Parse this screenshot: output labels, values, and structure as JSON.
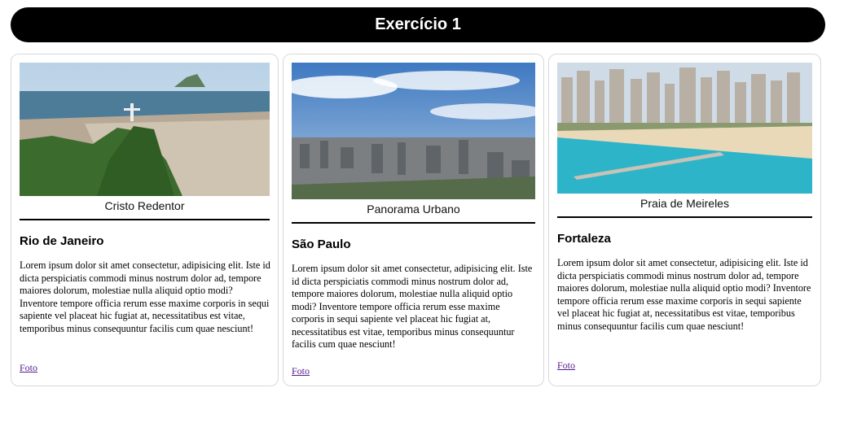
{
  "header": {
    "title": "Exercício 1"
  },
  "cards": [
    {
      "caption": "Cristo Redentor",
      "city": "Rio de Janeiro",
      "text": "Lorem ipsum dolor sit amet consectetur, adipisicing elit. Iste id dicta perspiciatis commodi minus nostrum dolor ad, tempore maiores dolorum, molestiae nulla aliquid optio modi? Inventore tempore officia rerum esse maxime corporis in sequi sapiente vel placeat hic fugiat at, necessitatibus est vitae, temporibus minus consequuntur facilis cum quae nesciunt!",
      "link": "Foto"
    },
    {
      "caption": "Panorama Urbano",
      "city": "São Paulo",
      "text": "Lorem ipsum dolor sit amet consectetur, adipisicing elit. Iste id dicta perspiciatis commodi minus nostrum dolor ad, tempore maiores dolorum, molestiae nulla aliquid optio modi? Inventore tempore officia rerum esse maxime corporis in sequi sapiente vel placeat hic fugiat at, necessitatibus est vitae, temporibus minus consequuntur facilis cum quae nesciunt!",
      "link": "Foto"
    },
    {
      "caption": "Praia de Meireles",
      "city": "Fortaleza",
      "text": "Lorem ipsum dolor sit amet consectetur, adipisicing elit. Iste id dicta perspiciatis commodi minus nostrum dolor ad, tempore maiores dolorum, molestiae nulla aliquid optio modi? Inventore tempore officia rerum esse maxime corporis in sequi sapiente vel placeat hic fugiat at, necessitatibus est vitae, temporibus minus consequuntur facilis cum quae nesciunt!",
      "link": "Foto"
    }
  ]
}
